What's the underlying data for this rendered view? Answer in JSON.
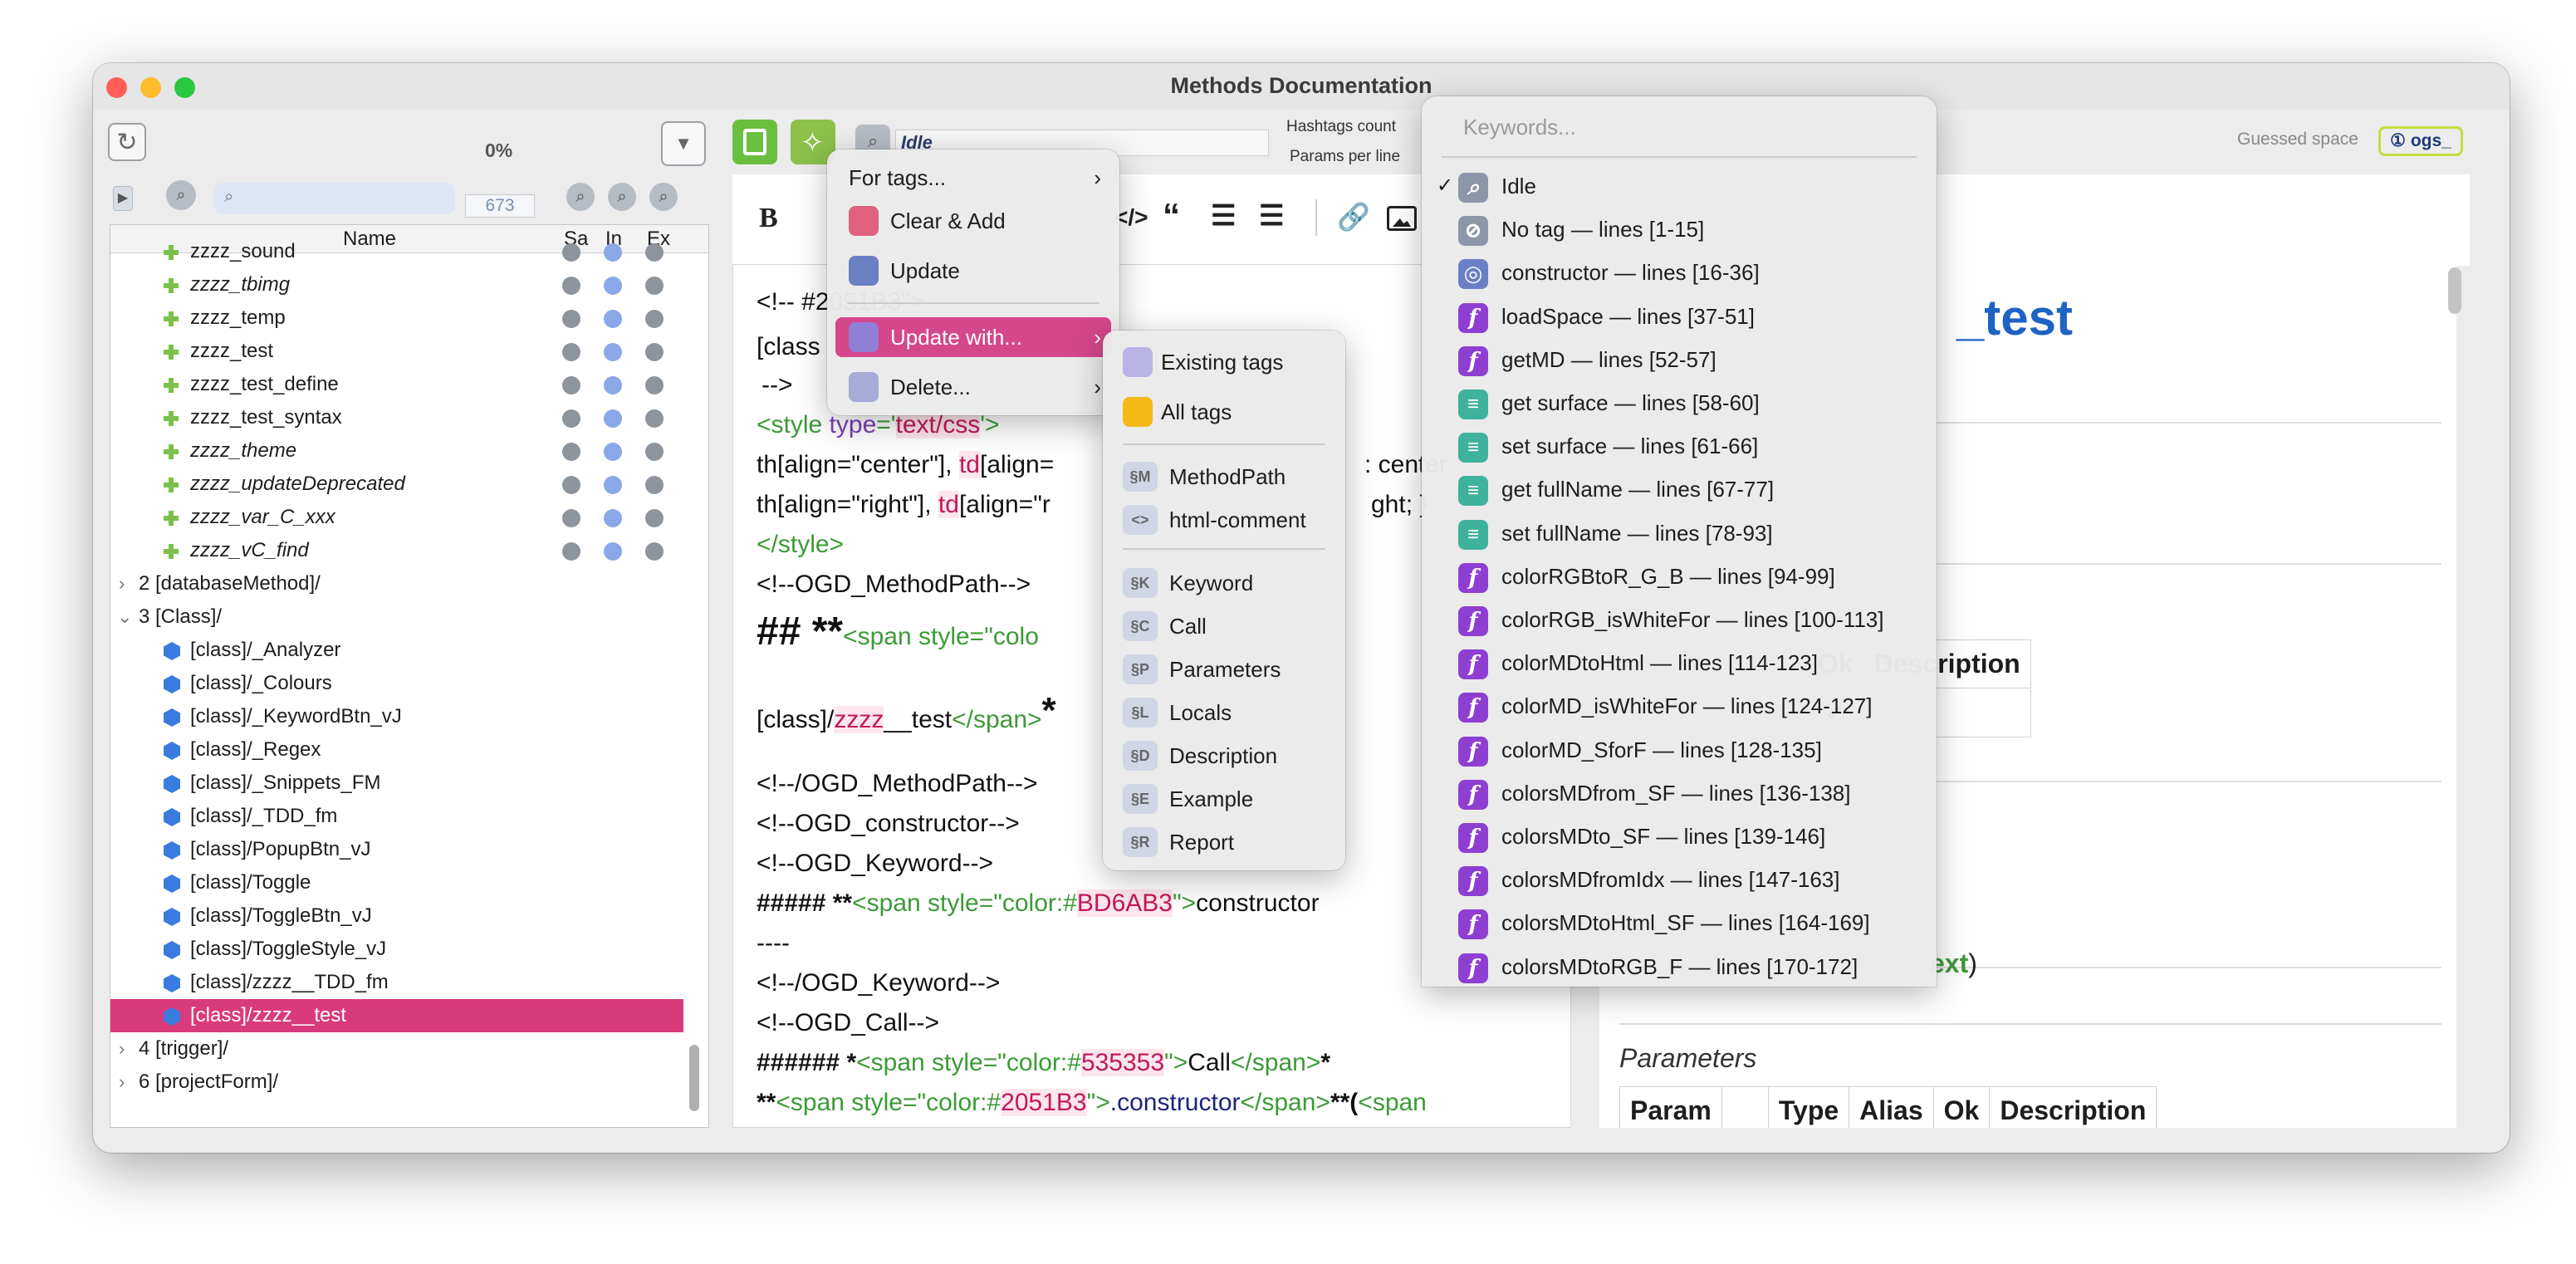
{
  "window": {
    "title": "Methods Documentation"
  },
  "left": {
    "progress": "0%",
    "count": "673",
    "columns": {
      "name": "Name",
      "sa": "Sa",
      "in": "In",
      "ex": "Ex"
    },
    "methods": [
      "zzzz_sound",
      "zzzz_tbimg",
      "zzzz_temp",
      "zzzz_test",
      "zzzz_test_define",
      "zzzz_test_syntax",
      "zzzz_theme",
      "zzzz_updateDeprecated",
      "zzzz_var_C_xxx",
      "zzzz_vC_find"
    ],
    "group2": "2 [databaseMethod]/",
    "group3": "3 [Class]/",
    "classes": [
      "[class]/_Analyzer",
      "[class]/_Colours",
      "[class]/_KeywordBtn_vJ",
      "[class]/_Regex",
      "[class]/_Snippets_FM",
      "[class]/_TDD_fm",
      "[class]/PopupBtn_vJ",
      "[class]/Toggle",
      "[class]/ToggleBtn_vJ",
      "[class]/ToggleStyle_vJ",
      "[class]/zzzz__TDD_fm",
      "[class]/zzzz__test"
    ],
    "group4": "4 [trigger]/",
    "group6": "6 [projectForm]/"
  },
  "toolbar": {
    "status": "Idle",
    "hashtags_label": "Hashtags count",
    "params_label": "Params per line",
    "guessed_space_label": "Guessed space",
    "guessed_space_value": "① ogs_"
  },
  "editor": {
    "line1": "<!-- #2051B3\">",
    "line2": "[class",
    "line3": "-->",
    "line4a": "<style ",
    "line4b": "type",
    "line4c": "='",
    "line4d": "text/css",
    "line4e": "'>",
    "line5a": "th[align=\"center\"], ",
    "line5b": "td",
    "line5c": "[align=",
    "line5d": ": center",
    "line6a": "th[align=\"right\"], ",
    "line6b": "td",
    "line6c": "[align=\"r",
    "line6d": "ght; }",
    "line7": "</style>",
    "line8": "<!--OGD_MethodPath-->",
    "line9a": "## **",
    "line9b": "<span style=\"colo",
    "line10a": "[class]/",
    "line10b": "zzzz",
    "line10c": "__test",
    "line10d": "</span>",
    "line10e": "*",
    "line11": "<!--/OGD_MethodPath-->",
    "line12": "<!--OGD_constructor-->",
    "line13": "<!--OGD_Keyword-->",
    "line14a": "##### **",
    "line14b": "<span style=\"color:#",
    "line14c": "BD6AB3",
    "line14d": "\">",
    "line14e": "constructor",
    "line15": "----",
    "line16": "<!--/OGD_Keyword-->",
    "line17": "<!--OGD_Call-->",
    "line18a": "###### *",
    "line18b": "<span style=\"color:#",
    "line18c": "535353",
    "line18d": "\">",
    "line18e": "Call",
    "line18f": "</span>",
    "line18g": "*",
    "line19a": "**",
    "line19b": "<span style=\"color:#",
    "line19c": "2051B3",
    "line19d": "\">",
    "line19e": ".constructor",
    "line19f": "</span>",
    "line19g": "**(",
    "line19h": "<span"
  },
  "preview": {
    "title": "_test",
    "table1": {
      "ok": "Ok",
      "description": "Description",
      "check": "✓"
    },
    "ext": "ext",
    "paren": ")",
    "parameters": "Parameters",
    "table2": [
      "Param",
      "",
      "Type",
      "Alias",
      "Ok",
      "Description"
    ]
  },
  "tags_menu": {
    "for_tags": "For tags...",
    "clear_add": "Clear & Add",
    "update": "Update",
    "update_with": "Update with...",
    "delete": "Delete..."
  },
  "submenu": {
    "existing": "Existing tags",
    "all": "All tags",
    "items": [
      {
        "code": "§M",
        "label": "MethodPath"
      },
      {
        "code": "<>",
        "label": "html-comment"
      },
      {
        "code": "§K",
        "label": "Keyword"
      },
      {
        "code": "§C",
        "label": "Call"
      },
      {
        "code": "§P",
        "label": "Parameters"
      },
      {
        "code": "§L",
        "label": "Locals"
      },
      {
        "code": "§D",
        "label": "Description"
      },
      {
        "code": "§E",
        "label": "Example"
      },
      {
        "code": "§R",
        "label": "Report"
      }
    ]
  },
  "keywords": {
    "placeholder": "Keywords...",
    "items": [
      {
        "label": "Idle",
        "badge": "gray",
        "glyph": "⌕",
        "checked": true
      },
      {
        "label": "No tag — lines [1-15]",
        "badge": "gray",
        "glyph": "⊘"
      },
      {
        "label": "constructor — lines [16-36]",
        "badge": "grayb",
        "glyph": "◎"
      },
      {
        "label": "loadSpace — lines [37-51]",
        "badge": "purple",
        "glyph": "f"
      },
      {
        "label": "getMD — lines [52-57]",
        "badge": "purple",
        "glyph": "f"
      },
      {
        "label": "get surface — lines [58-60]",
        "badge": "teal",
        "glyph": "≡"
      },
      {
        "label": "set surface — lines [61-66]",
        "badge": "teal",
        "glyph": "≡"
      },
      {
        "label": "get fullName — lines [67-77]",
        "badge": "teal",
        "glyph": "≡"
      },
      {
        "label": "set fullName — lines [78-93]",
        "badge": "teal",
        "glyph": "≡"
      },
      {
        "label": "colorRGBtoR_G_B — lines [94-99]",
        "badge": "purple",
        "glyph": "f"
      },
      {
        "label": "colorRGB_isWhiteFor — lines [100-113]",
        "badge": "purple",
        "glyph": "f"
      },
      {
        "label": "colorMDtoHtml — lines [114-123]",
        "badge": "purple",
        "glyph": "f"
      },
      {
        "label": "colorMD_isWhiteFor — lines [124-127]",
        "badge": "purple",
        "glyph": "f"
      },
      {
        "label": "colorMD_SforF — lines [128-135]",
        "badge": "purple",
        "glyph": "f"
      },
      {
        "label": "colorsMDfrom_SF — lines [136-138]",
        "badge": "purple",
        "glyph": "f"
      },
      {
        "label": "colorsMDto_SF — lines [139-146]",
        "badge": "purple",
        "glyph": "f"
      },
      {
        "label": "colorsMDfromIdx — lines [147-163]",
        "badge": "purple",
        "glyph": "f"
      },
      {
        "label": "colorsMDtoHtml_SF — lines [164-169]",
        "badge": "purple",
        "glyph": "f"
      },
      {
        "label": "colorsMDtoRGB_F — lines [170-172]",
        "badge": "purple",
        "glyph": "f"
      }
    ]
  },
  "colors": {
    "accent": "#d93a7c",
    "save": "#6abf3e",
    "link": "#1e63c4"
  }
}
